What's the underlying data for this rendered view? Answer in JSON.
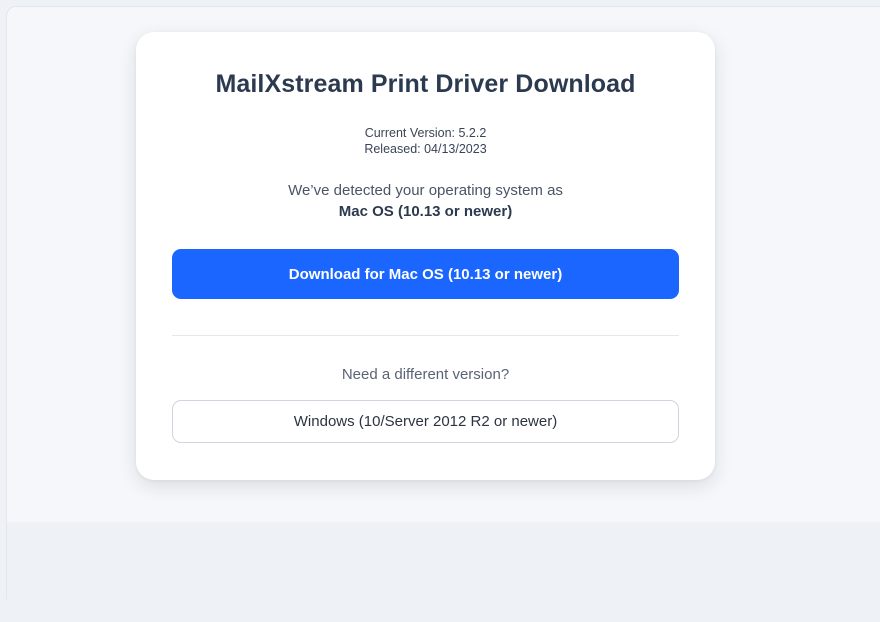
{
  "card": {
    "title": "MailXstream Print Driver Download",
    "current_version": "Current Version: 5.2.2",
    "released": "Released: 04/13/2023",
    "detected_text": "We’ve detected your operating system as",
    "detected_os": "Mac OS (10.13 or newer)",
    "primary_button_label": "Download for Mac OS (10.13 or newer)",
    "alternate_prompt": "Need a different version?",
    "alternate_button_label": "Windows (10/Server 2012 R2 or newer)"
  },
  "colors": {
    "primary": "#1a66ff",
    "title": "#2c3a4f",
    "background": "#f5f7fa"
  }
}
